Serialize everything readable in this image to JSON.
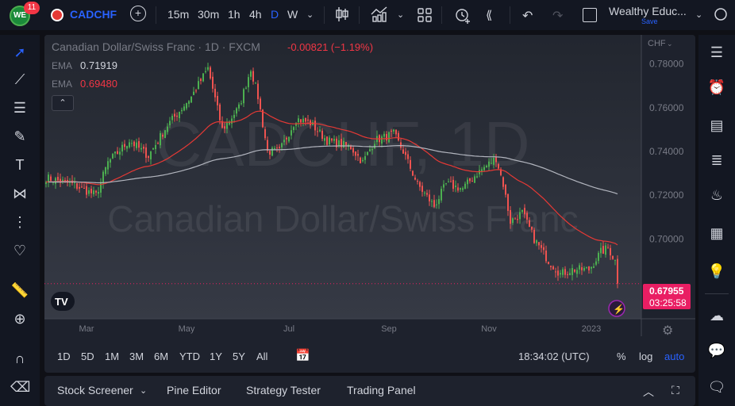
{
  "topbar": {
    "notif_count": "11",
    "symbol": "CADCHF",
    "intervals": [
      "15m",
      "30m",
      "1h",
      "4h",
      "D",
      "W"
    ],
    "active_interval": "D",
    "layout_name": "Wealthy Educ...",
    "save_label": "Save"
  },
  "legend": {
    "title": "Canadian Dollar/Swiss Franc · 1D · FXCM",
    "change": "-0.00821 (−1.19%)",
    "ema1_label": "EMA",
    "ema1_value": "0.71919",
    "ema2_label": "EMA",
    "ema2_value": "0.69480"
  },
  "watermark": {
    "line1": "CADCHF, 1D",
    "line2": "Canadian Dollar/Swiss Franc"
  },
  "price_axis": {
    "currency": "CHF",
    "last_price": "0.67955",
    "countdown": "03:25:58"
  },
  "timeframes": [
    "1D",
    "5D",
    "1M",
    "3M",
    "6M",
    "YTD",
    "1Y",
    "5Y",
    "All"
  ],
  "time_status": {
    "clock": "18:34:02 (UTC)",
    "percent": "%",
    "log": "log",
    "auto": "auto"
  },
  "bottom_tabs": [
    "Stock Screener",
    "Pine Editor",
    "Strategy Tester",
    "Trading Panel"
  ],
  "colors": {
    "up": "#26a69a",
    "down": "#ef5350",
    "up_candle": "#4caf50",
    "ema_fast": "#e53935",
    "ema_slow": "#b2b5be",
    "accent": "#2962ff",
    "price_label": "#e91e63"
  },
  "chart_data": {
    "type": "candlestick",
    "title": "CADCHF, 1D",
    "y_ticks": [
      "0.78000",
      "0.76000",
      "0.74000",
      "0.72000",
      "0.70000"
    ],
    "y_tick_values": [
      0.78,
      0.76,
      0.74,
      0.72,
      0.7
    ],
    "ylim": [
      0.6635,
      0.7933
    ],
    "x_ticks": [
      "Mar",
      "May",
      "Jul",
      "Sep",
      "Nov",
      "2023"
    ],
    "x_tick_index": [
      17,
      59,
      102,
      144,
      186,
      229
    ],
    "candle_count": 241,
    "close_path": [
      [
        0,
        0.728
      ],
      [
        11,
        0.725
      ],
      [
        21,
        0.72
      ],
      [
        26,
        0.735
      ],
      [
        35,
        0.745
      ],
      [
        43,
        0.738
      ],
      [
        51,
        0.752
      ],
      [
        61,
        0.765
      ],
      [
        68,
        0.778
      ],
      [
        74,
        0.75
      ],
      [
        81,
        0.76
      ],
      [
        86,
        0.778
      ],
      [
        89,
        0.765
      ],
      [
        93,
        0.74
      ],
      [
        98,
        0.74
      ],
      [
        105,
        0.755
      ],
      [
        111,
        0.753
      ],
      [
        118,
        0.745
      ],
      [
        128,
        0.742
      ],
      [
        133,
        0.735
      ],
      [
        138,
        0.745
      ],
      [
        146,
        0.748
      ],
      [
        150,
        0.74
      ],
      [
        156,
        0.725
      ],
      [
        163,
        0.715
      ],
      [
        168,
        0.725
      ],
      [
        175,
        0.723
      ],
      [
        181,
        0.73
      ],
      [
        189,
        0.737
      ],
      [
        192,
        0.725
      ],
      [
        195,
        0.708
      ],
      [
        200,
        0.712
      ],
      [
        205,
        0.7
      ],
      [
        211,
        0.69
      ],
      [
        216,
        0.684
      ],
      [
        221,
        0.686
      ],
      [
        228,
        0.686
      ],
      [
        233,
        0.694
      ],
      [
        236,
        0.696
      ],
      [
        239,
        0.69
      ],
      [
        240,
        0.68
      ]
    ],
    "last_close": 0.67955,
    "ema_periods": [
      50,
      200
    ]
  }
}
